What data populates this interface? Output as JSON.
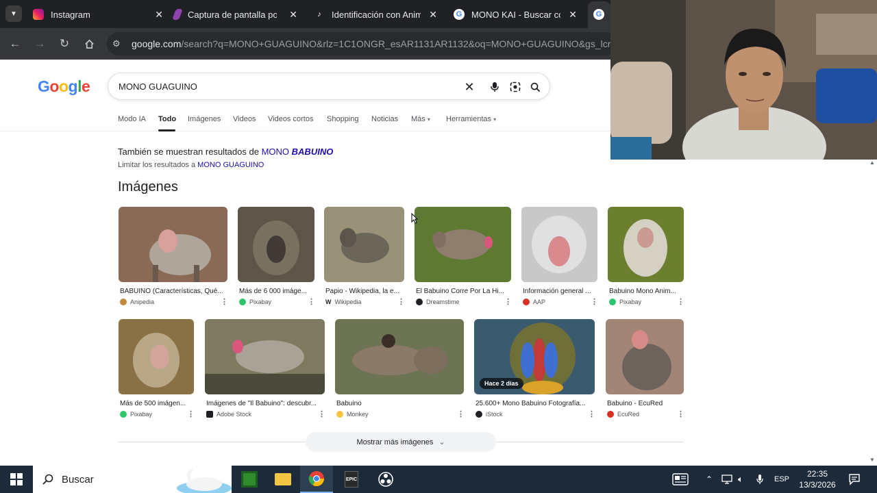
{
  "browser": {
    "tabs": [
      {
        "title": "Instagram",
        "close": "✕"
      },
      {
        "title": "Captura de pantalla por",
        "close": "✕"
      },
      {
        "title": "Identificación con Anim",
        "close": "✕"
      },
      {
        "title": "MONO KAI - Buscar con",
        "close": "✕"
      }
    ],
    "url_domain": "google.com",
    "url_rest": "/search?q=MONO+GUAGUINO&rlz=1C1ONGR_esAR1131AR1132&oq=MONO+GUAGUINO&gs_lcrp"
  },
  "google": {
    "logo": [
      "G",
      "o",
      "o",
      "g",
      "l",
      "e"
    ],
    "logo_colors": [
      "#4285f4",
      "#ea4335",
      "#fbbc05",
      "#4285f4",
      "#34a853",
      "#ea4335"
    ],
    "query": "MONO GUAGUINO",
    "tabs": [
      "Modo IA",
      "Todo",
      "Imágenes",
      "Videos",
      "Videos cortos",
      "Shopping",
      "Noticias",
      "Más",
      "Herramientas"
    ],
    "more_caret": "▾",
    "tools_caret": "▾",
    "also_prefix": "También se muestran resultados de",
    "also_link_plain": "MONO",
    "also_link_bold": "BABUINO",
    "limit_prefix": "Limitar los resultados a",
    "limit_link": "MONO GUAGUINO",
    "images_heading": "Imágenes",
    "show_more": "Mostrar más imágenes",
    "show_more_caret": "⌄"
  },
  "images": [
    {
      "title": "BABUINO (Características, Qué...",
      "source": "Anipedia",
      "color": "#8a6a55"
    },
    {
      "title": "Más de 6 000 imáge...",
      "source": "Pixabay",
      "color": "#5d5548"
    },
    {
      "title": "Papio - Wikipedia, la e...",
      "source": "Wikipedia",
      "color": "#7f7b6a"
    },
    {
      "title": "El Babuino Corre Por La Hi...",
      "source": "Dreamstime",
      "color": "#5e7a32"
    },
    {
      "title": "Información general ...",
      "source": "AAP",
      "color": "#a9a9a9"
    },
    {
      "title": "Babuino Mono Anim...",
      "source": "Pixabay",
      "color": "#6b7f2e"
    },
    {
      "title": "Más de 500 imágen...",
      "source": "Pixabay",
      "color": "#8a7045"
    },
    {
      "title": "Imágenes de \"Il Babuino\": descubr...",
      "source": "Adobe Stock",
      "color": "#7d7a60"
    },
    {
      "title": "Babuino",
      "source": "Monkey",
      "color": "#6c7453"
    },
    {
      "title": "25.600+ Mono Babuino Fotografía...",
      "source": "iStock",
      "color": "#3a5a70",
      "badge": "Hace 2 días"
    },
    {
      "title": "Babuino - EcuRed",
      "source": "EcuRed",
      "color": "#a38578"
    }
  ],
  "source_colors": {
    "Anipedia": "#c28a3a",
    "Pixabay": "#2ec66d",
    "Wikipedia": "#202124",
    "Dreamstime": "#202124",
    "AAP": "#d93025",
    "Adobe Stock": "#202124",
    "Monkey": "#f4c542",
    "iStock": "#202124",
    "EcuRed": "#d93025"
  },
  "taskbar": {
    "search_label": "Buscar",
    "language": "ESP",
    "time": "22:35",
    "date": "13/3/2026"
  }
}
